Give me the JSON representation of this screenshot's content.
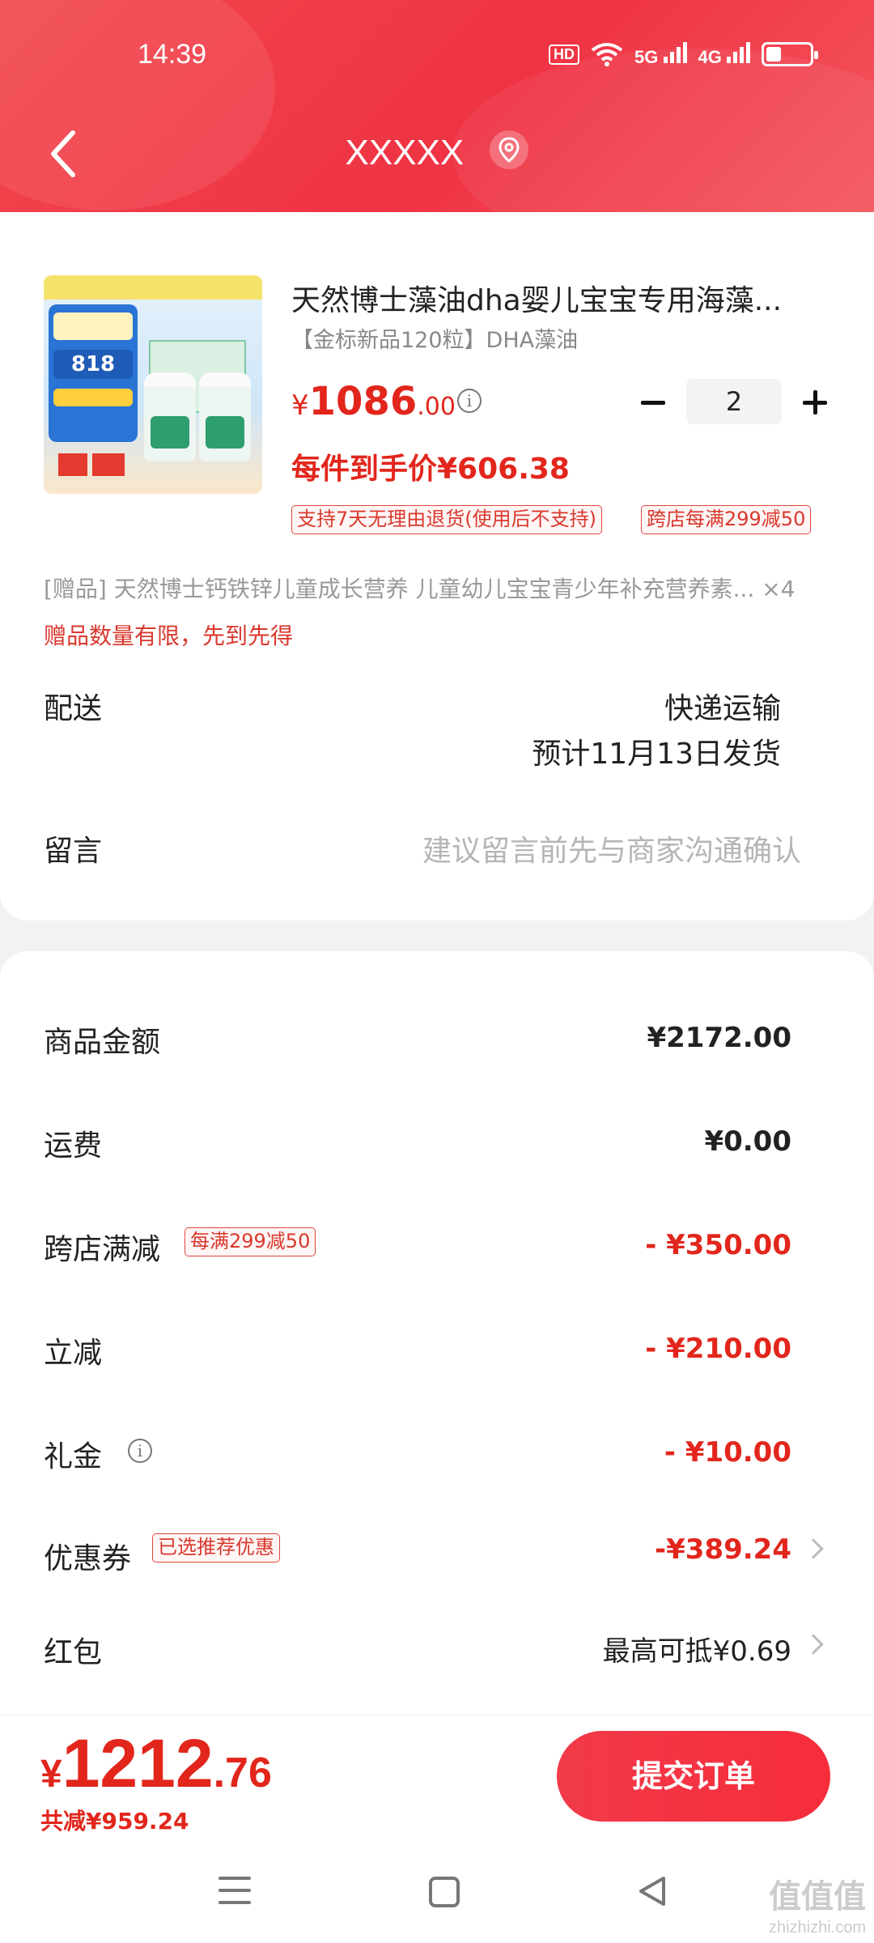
{
  "status_bar": {
    "time": "14:39",
    "hd_label": "HD",
    "net1": "5G",
    "net2": "4G"
  },
  "nav": {
    "title": "XXXXX"
  },
  "product": {
    "title": "天然博士藻油dha婴儿宝宝专用海藻...",
    "spec": "【金标新品120粒】DHA藻油",
    "price_currency": "¥",
    "price_int": "1086",
    "price_dec": ".00",
    "quantity": "2",
    "unit_price": "每件到手价¥606.38",
    "tags": [
      "支持7天无理由退货(使用后不支持)",
      "跨店每满299减50"
    ]
  },
  "gift": {
    "text": "[赠品] 天然博士钙铁锌儿童成长营养 儿童幼儿宝宝青少年补充营养素... ×4",
    "note": "赠品数量有限，先到先得"
  },
  "delivery": {
    "label": "配送",
    "method": "快递运输",
    "eta": "预计11月13日发货"
  },
  "message": {
    "label": "留言",
    "placeholder": "建议留言前先与商家沟通确认"
  },
  "summary": {
    "goods_label": "商品金额",
    "goods_value": "¥2172.00",
    "shipping_label": "运费",
    "shipping_value": "¥0.00",
    "cross_label": "跨店满减",
    "cross_tag": "每满299减50",
    "cross_value": "- ¥350.00",
    "instant_label": "立减",
    "instant_value": "- ¥210.00",
    "gift_money_label": "礼金",
    "gift_money_value": "- ¥10.00",
    "coupon_label": "优惠券",
    "coupon_tag": "已选推荐优惠",
    "coupon_value": "-¥389.24",
    "redpacket_label": "红包",
    "redpacket_value": "最高可抵¥0.69"
  },
  "footer": {
    "total_currency": "¥",
    "total_int": "1212",
    "total_dec": ".76",
    "saved": "共减¥959.24",
    "submit_label": "提交订单"
  },
  "thumbnail": {
    "promo_amount": "818"
  },
  "watermark": {
    "main": "值值值",
    "sub": "zhizhizhi.com"
  },
  "colors": {
    "accent": "#e2261c",
    "header": "#ef3344"
  }
}
